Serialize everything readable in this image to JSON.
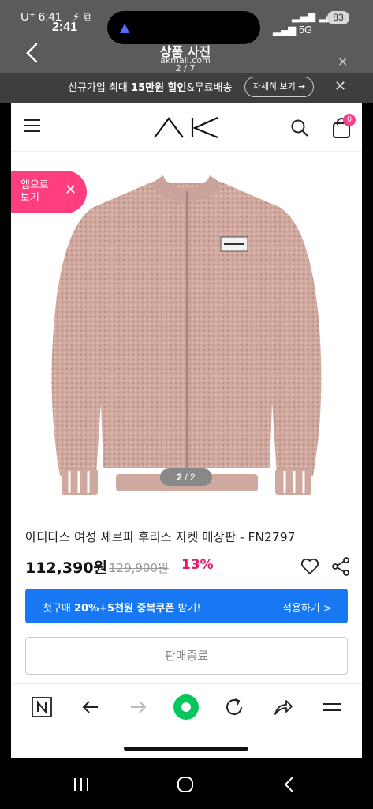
{
  "outer_status": {
    "carrier": "U⁺ 6:41",
    "icons": "⚡ ⧉",
    "signal": "▂▄▆ ▂▄▆",
    "battery": "83"
  },
  "inner_status": {
    "time": "2:41",
    "signal": "▂▄▆ 5G"
  },
  "viewer": {
    "title": "상품 사진",
    "domain": "akmall.com",
    "counter": "2 / 7",
    "close": "×"
  },
  "promo": {
    "text_prefix": "신규가입 최대 ",
    "text_bold": "15만원 할인",
    "text_suffix": "&무료배송",
    "button": "자세히 보기 ➔",
    "close": "✕"
  },
  "header": {
    "cart_count": "0"
  },
  "app_pill": {
    "label_line1": "앱으로",
    "label_line2": "보기",
    "close": "✕"
  },
  "image_counter": {
    "current": "2",
    "sep": " / ",
    "total": "2"
  },
  "product": {
    "name": "아디다스 여성 셰르파 후리스 자켓 매장판 - FN2797",
    "price": "112,390원",
    "original_price": "129,900원",
    "discount": "13%"
  },
  "coupon": {
    "text_prefix": "첫구매 ",
    "text_bold": "20%+5천원 중복쿠폰",
    "text_suffix": " 받기!",
    "apply": "적용하기 >"
  },
  "soldout_button": "판매종료",
  "colors": {
    "accent_pink": "#ff3d7f",
    "discount_pink": "#e8196b",
    "coupon_blue": "#1877f2",
    "naver_green": "#03c75a"
  },
  "browser_bar_icons": [
    "naver-n-icon",
    "back-arrow-icon",
    "forward-arrow-icon",
    "green-dot-icon",
    "refresh-icon",
    "share-icon",
    "menu-icon"
  ]
}
